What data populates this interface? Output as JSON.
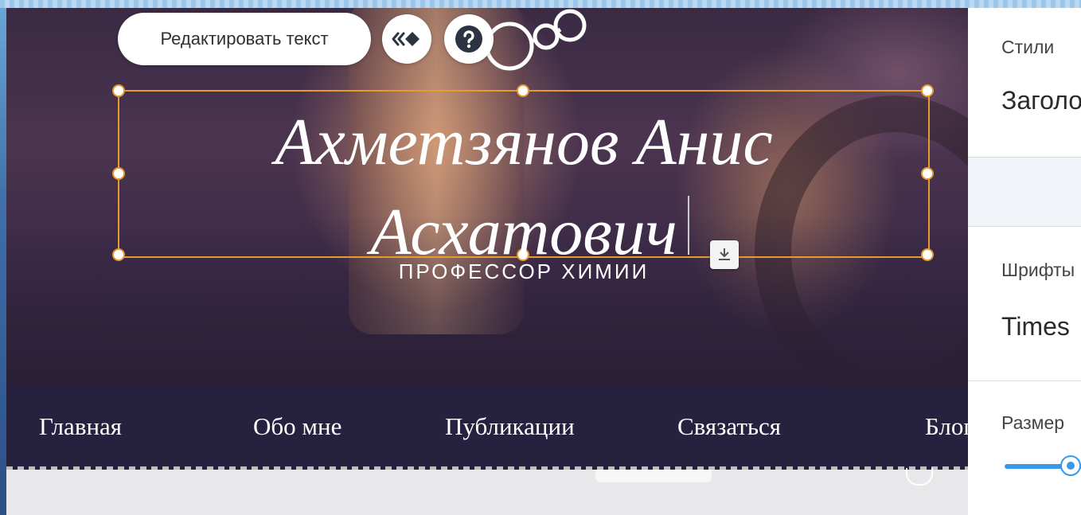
{
  "toolbar": {
    "edit_text_label": "Редактировать текст",
    "animation_icon": "animation-icon",
    "help_icon": "help-icon"
  },
  "hero": {
    "heading_line1": "Ахметзянов Анис",
    "heading_line2": "Асхатович",
    "subtitle": "ПРОФЕССОР ХИМИИ"
  },
  "nav": {
    "items": [
      {
        "label": "Главная"
      },
      {
        "label": "Обо мне"
      },
      {
        "label": "Публикации"
      },
      {
        "label": "Связаться"
      },
      {
        "label": "Блог"
      }
    ]
  },
  "panel": {
    "styles_label": "Стили",
    "styles_value": "Заголовок",
    "font_label": "Шрифты",
    "font_value": "Times",
    "size_label": "Размер",
    "size_slider_level": 0.9
  },
  "colors": {
    "selection": "#e89a2e",
    "nav_background": "#272140",
    "accent": "#3899ec"
  }
}
